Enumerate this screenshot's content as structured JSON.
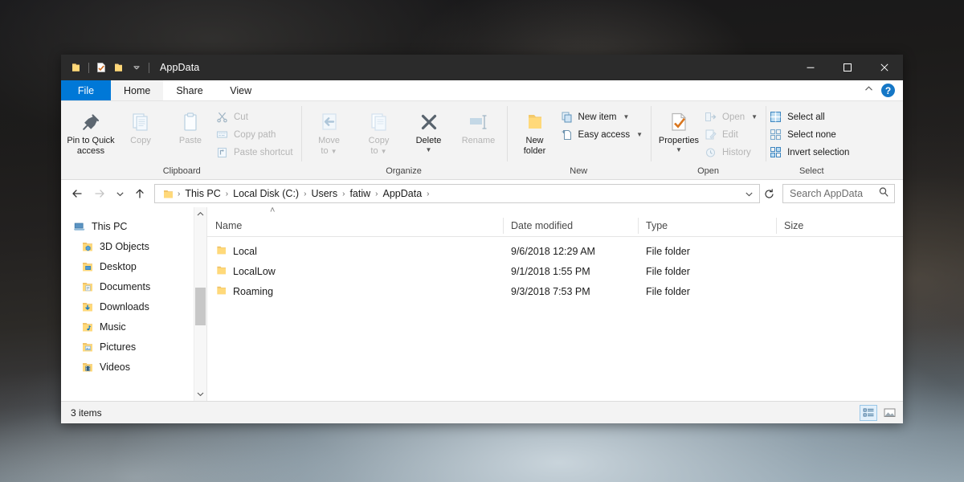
{
  "window": {
    "title": "AppData",
    "quick_access": [
      {
        "name": "folder-icon",
        "label": "Properties"
      },
      {
        "name": "properties-check-icon",
        "label": "Properties"
      },
      {
        "name": "new-folder-icon",
        "label": "New folder"
      },
      {
        "name": "chevron-down-icon",
        "label": "Customize Quick Access Toolbar"
      }
    ],
    "controls": {
      "minimize": "Minimize",
      "maximize": "Maximize",
      "close": "Close"
    }
  },
  "tabs": [
    {
      "label": "File",
      "active": false,
      "kind": "file"
    },
    {
      "label": "Home",
      "active": true,
      "kind": "normal"
    },
    {
      "label": "Share",
      "active": false,
      "kind": "normal"
    },
    {
      "label": "View",
      "active": false,
      "kind": "normal"
    }
  ],
  "tab_right": {
    "collapse_label": "Minimize the Ribbon",
    "help_label": "?"
  },
  "ribbon": {
    "groups": [
      {
        "label": "Clipboard",
        "big": [
          {
            "label_line1": "Pin to Quick",
            "label_line2": "access",
            "icon": "pin-icon",
            "disabled": false
          },
          {
            "label_line1": "Copy",
            "label_line2": "",
            "icon": "copy-icon",
            "disabled": true
          },
          {
            "label_line1": "Paste",
            "label_line2": "",
            "icon": "paste-icon",
            "disabled": true
          }
        ],
        "small": [
          {
            "label": "Cut",
            "icon": "scissors-icon",
            "disabled": true
          },
          {
            "label": "Copy path",
            "icon": "copy-path-icon",
            "disabled": true
          },
          {
            "label": "Paste shortcut",
            "icon": "paste-shortcut-icon",
            "disabled": true
          }
        ]
      },
      {
        "label": "Organize",
        "big": [
          {
            "label_line1": "Move",
            "label_line2": "to",
            "icon": "move-to-icon",
            "disabled": true,
            "caret": true
          },
          {
            "label_line1": "Copy",
            "label_line2": "to",
            "icon": "copy-to-icon",
            "disabled": true,
            "caret": true
          },
          {
            "label_line1": "Delete",
            "label_line2": "",
            "icon": "delete-x-icon",
            "disabled": false,
            "caret": true
          },
          {
            "label_line1": "Rename",
            "label_line2": "",
            "icon": "rename-icon",
            "disabled": true
          }
        ],
        "small": []
      },
      {
        "label": "New",
        "big": [
          {
            "label_line1": "New",
            "label_line2": "folder",
            "icon": "new-folder-icon",
            "disabled": false
          }
        ],
        "small": [
          {
            "label": "New item",
            "icon": "new-item-icon",
            "disabled": false,
            "caret": true
          },
          {
            "label": "Easy access",
            "icon": "easy-access-icon",
            "disabled": false,
            "caret": true
          }
        ]
      },
      {
        "label": "Open",
        "big": [
          {
            "label_line1": "Properties",
            "label_line2": "",
            "icon": "properties-check-icon",
            "disabled": false,
            "caret": true
          }
        ],
        "small": [
          {
            "label": "Open",
            "icon": "open-icon",
            "disabled": true,
            "caret": true
          },
          {
            "label": "Edit",
            "icon": "edit-icon",
            "disabled": true
          },
          {
            "label": "History",
            "icon": "history-icon",
            "disabled": true
          }
        ]
      },
      {
        "label": "Select",
        "big": [],
        "small": [
          {
            "label": "Select all",
            "icon": "select-all-icon",
            "disabled": false
          },
          {
            "label": "Select none",
            "icon": "select-none-icon",
            "disabled": false
          },
          {
            "label": "Invert selection",
            "icon": "invert-selection-icon",
            "disabled": false
          }
        ]
      }
    ]
  },
  "address": {
    "back": "Back",
    "forward": "Forward",
    "recent": "Recent locations",
    "up": "Up to Users",
    "folder_icon": "folder-icon",
    "breadcrumbs": [
      "This PC",
      "Local Disk (C:)",
      "Users",
      "fatiw",
      "AppData"
    ],
    "separator": "›",
    "history_dropdown": "Previous locations",
    "refresh": "Refresh AppData",
    "search_placeholder": "Search AppData",
    "search_value": ""
  },
  "nav_pane": {
    "items": [
      {
        "label": "This PC",
        "icon": "this-pc-icon",
        "level": 0
      },
      {
        "label": "3D Objects",
        "icon": "folder-3d-icon",
        "level": 1
      },
      {
        "label": "Desktop",
        "icon": "folder-desktop-icon",
        "level": 1
      },
      {
        "label": "Documents",
        "icon": "folder-documents-icon",
        "level": 1
      },
      {
        "label": "Downloads",
        "icon": "folder-downloads-icon",
        "level": 1
      },
      {
        "label": "Music",
        "icon": "folder-music-icon",
        "level": 1
      },
      {
        "label": "Pictures",
        "icon": "folder-pictures-icon",
        "level": 1
      },
      {
        "label": "Videos",
        "icon": "folder-videos-icon",
        "level": 1
      }
    ],
    "scrollbar": {
      "up": "Scroll up",
      "down": "Scroll down"
    }
  },
  "file_list": {
    "sort_indicator": "˄",
    "columns": [
      {
        "label": "Name",
        "key": "name"
      },
      {
        "label": "Date modified",
        "key": "date"
      },
      {
        "label": "Type",
        "key": "type"
      },
      {
        "label": "Size",
        "key": "size"
      }
    ],
    "rows": [
      {
        "name": "Local",
        "date": "9/6/2018 12:29 AM",
        "type": "File folder",
        "size": "",
        "icon": "folder-icon"
      },
      {
        "name": "LocalLow",
        "date": "9/1/2018 1:55 PM",
        "type": "File folder",
        "size": "",
        "icon": "folder-icon"
      },
      {
        "name": "Roaming",
        "date": "9/3/2018 7:53 PM",
        "type": "File folder",
        "size": "",
        "icon": "folder-icon"
      }
    ]
  },
  "status_bar": {
    "item_count": "3 items",
    "view_details": "Details view",
    "view_large_icons": "Large icons view"
  },
  "colors": {
    "accent": "#0078d7",
    "titlebar": "#2b2b2b",
    "ribbon": "#f3f3f3",
    "folder_yellow": "#ffd066",
    "help_blue": "#1577c6"
  }
}
